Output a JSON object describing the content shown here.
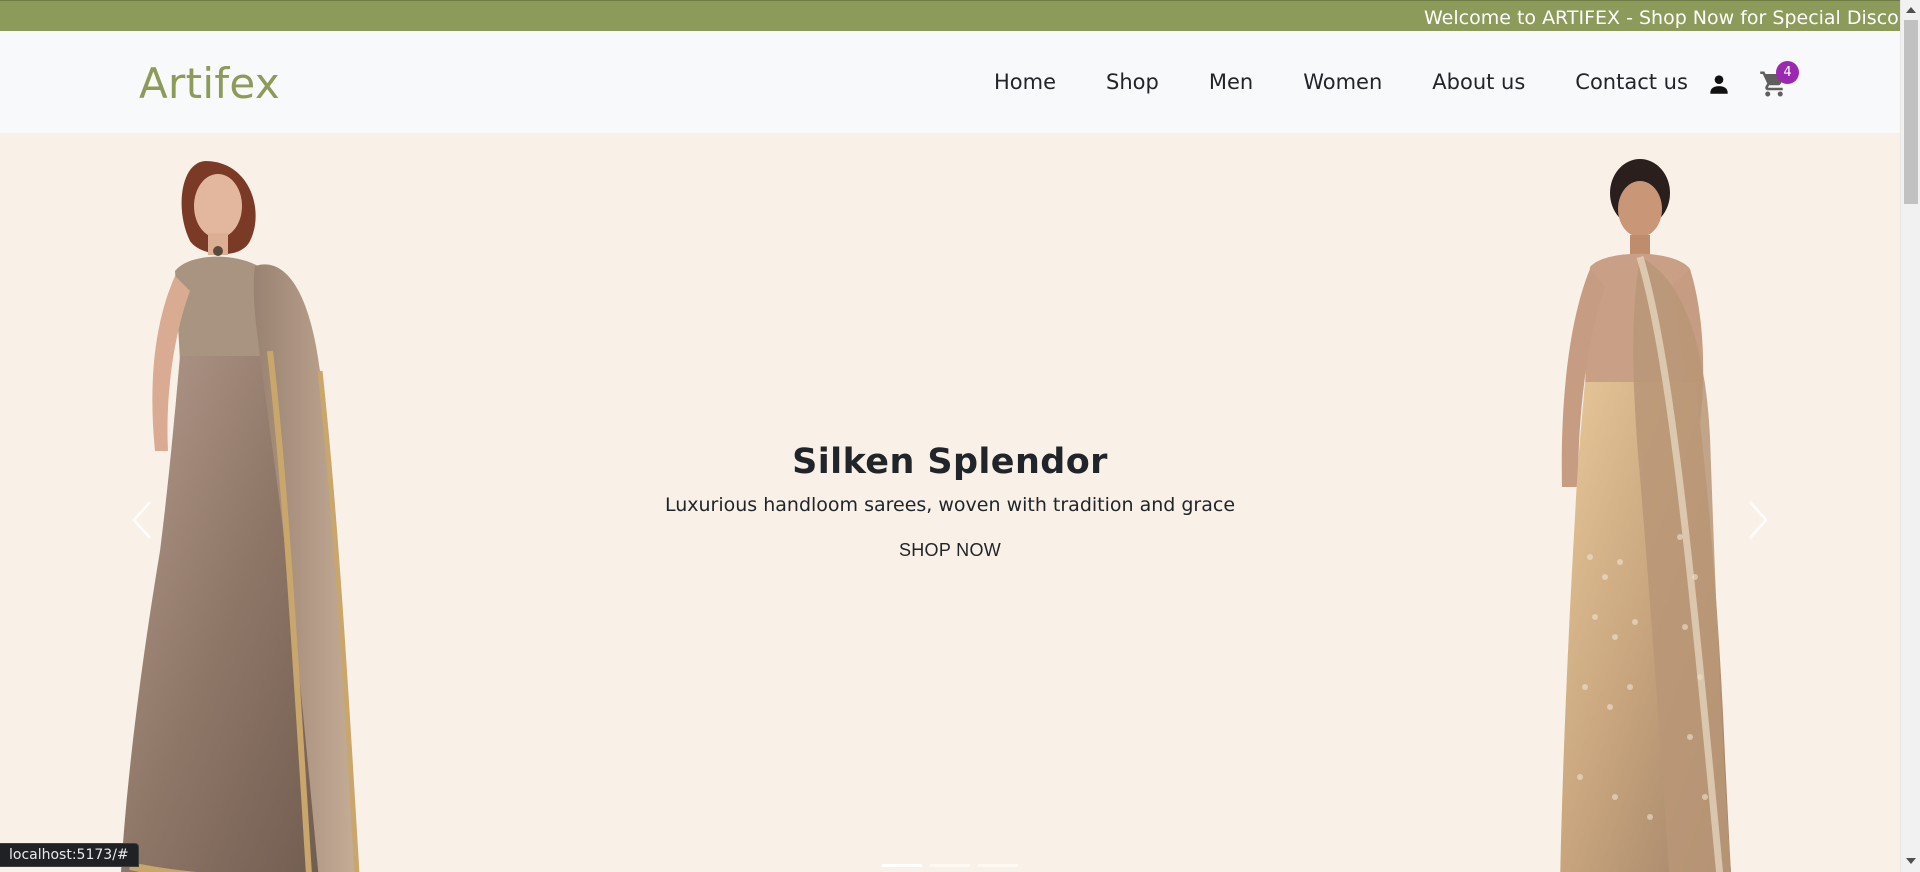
{
  "announcement": {
    "text": "Welcome to ARTIFEX - Shop Now for Special Discount"
  },
  "navbar": {
    "brand": "Artifex",
    "links": [
      {
        "label": "Home"
      },
      {
        "label": "Shop"
      },
      {
        "label": "Men"
      },
      {
        "label": "Women"
      },
      {
        "label": "About us"
      },
      {
        "label": "Contact us"
      }
    ],
    "user_icon": "person-icon",
    "cart_icon": "shopping-cart-icon",
    "cart_count": "4"
  },
  "hero": {
    "title": "Silken Splendor",
    "subtitle": "Luxurious handloom sarees, woven with tradition and grace",
    "button_label": "SHOP NOW",
    "prev_icon": "chevron-left-icon",
    "next_icon": "chevron-right-icon",
    "slide_count": 3,
    "active_slide": 1
  },
  "status_bar": {
    "url": "localhost:5173/#"
  },
  "colors": {
    "brand": "#8c9b5a",
    "announcement_bg": "#8c9b5a",
    "hero_bg": "#f9f1e8",
    "badge": "#9c27b0",
    "navbar_bg": "#f8f9fa"
  }
}
